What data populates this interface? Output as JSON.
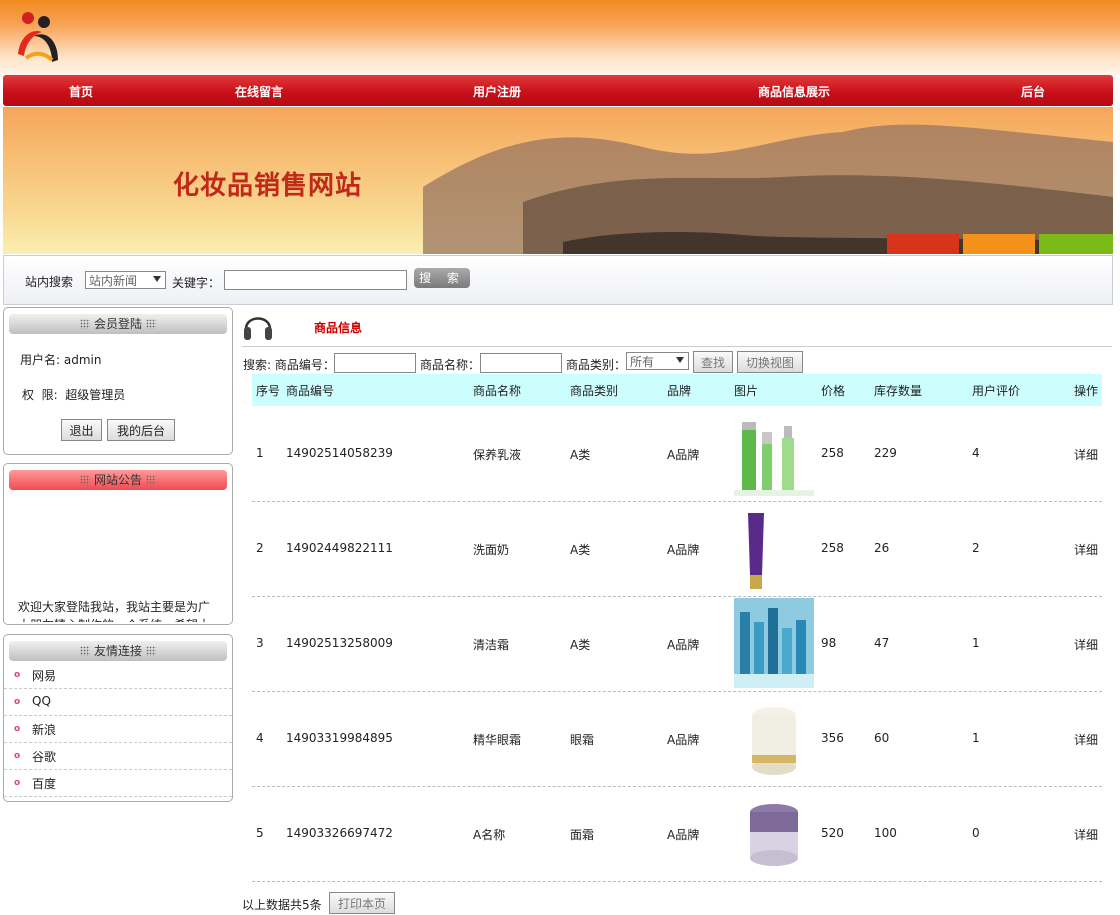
{
  "nav": [
    "首页",
    "在线留言",
    "用户注册",
    "商品信息展示",
    "后台"
  ],
  "banner_title": "化妆品销售网站",
  "search": {
    "label": "站内搜索",
    "select_value": "站内新闻",
    "keyword_label": "关键字：",
    "button": "搜 索"
  },
  "login_panel": {
    "title": "会员登陆",
    "username_label": "用户名: admin",
    "role_label": "权  限:  超级管理员",
    "logout": "退出",
    "my_admin": "我的后台"
  },
  "notice_panel": {
    "title": "网站公告",
    "text": "欢迎大家登陆我站，我站主要是为广大朋友精心制作的一个系统，希望大家喜欢"
  },
  "links_panel": {
    "title": "友情连接",
    "items": [
      "网易",
      "QQ",
      "新浪",
      "谷歌",
      "百度"
    ]
  },
  "main": {
    "title": "商品信息",
    "search_prefix": "搜索: 商品编号：",
    "name_label": "商品名称：",
    "category_label": "商品类别：",
    "category_value": "所有",
    "find_button": "查找",
    "switch_button": "切换视图"
  },
  "table": {
    "headers": [
      "序号",
      "商品编号",
      "商品名称",
      "商品类别",
      "品牌",
      "图片",
      "价格",
      "库存数量",
      "用户评价",
      "操作"
    ],
    "rows": [
      {
        "no": "1",
        "code": "14902514058239",
        "name": "保养乳液",
        "cat": "A类",
        "brand": "A品牌",
        "img": "green-bottles",
        "price": "258",
        "stock": "229",
        "rating": "4",
        "op": "详细"
      },
      {
        "no": "2",
        "code": "14902449822111",
        "name": "洗面奶",
        "cat": "A类",
        "brand": "A品牌",
        "img": "purple-tube",
        "price": "258",
        "stock": "26",
        "rating": "2",
        "op": "详细"
      },
      {
        "no": "3",
        "code": "14902513258009",
        "name": "清洁霜",
        "cat": "A类",
        "brand": "A品牌",
        "img": "blue-bottles",
        "price": "98",
        "stock": "47",
        "rating": "1",
        "op": "详细"
      },
      {
        "no": "4",
        "code": "14903319984895",
        "name": "精华眼霜",
        "cat": "眼霜",
        "brand": "A品牌",
        "img": "cream-jar",
        "price": "356",
        "stock": "60",
        "rating": "1",
        "op": "详细"
      },
      {
        "no": "5",
        "code": "14903326697472",
        "name": "A名称",
        "cat": "面霜",
        "brand": "A品牌",
        "img": "purple-jar",
        "price": "520",
        "stock": "100",
        "rating": "0",
        "op": "详细"
      }
    ]
  },
  "footer": {
    "count_text": "以上数据共5条",
    "print_button": "打印本页"
  }
}
